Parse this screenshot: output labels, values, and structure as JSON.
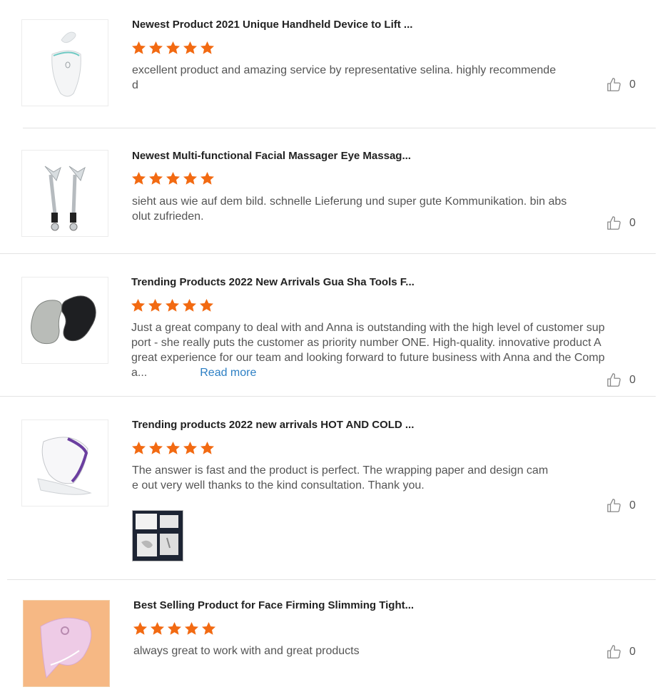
{
  "colors": {
    "star": "#f26a12",
    "link": "#2c7fc4",
    "divider": "#e3e3e3"
  },
  "reviews": [
    {
      "title": "Newest Product 2021 Unique Handheld Device to Lift ...",
      "rating": 5,
      "text": "excellent product and amazing service by representative selina. highly recommended",
      "likes": "0",
      "thumbnail_icon": "facial-lift-device-icon"
    },
    {
      "title": "Newest Multi-functional Facial Massager Eye Massag...",
      "rating": 5,
      "text": "sieht aus wie auf dem bild. schnelle Lieferung und super gute Kommunikation. bin absolut zufrieden.",
      "likes": "0",
      "thumbnail_icon": "eye-massager-icon"
    },
    {
      "title": "Trending Products 2022 New Arrivals Gua Sha Tools F...",
      "rating": 5,
      "text": "Just a great company to deal with and Anna is outstanding with the high level of customer support - she really puts the customer as priority number ONE. High-quality. innovative product A great experience for our team and looking forward to future business with Anna and the Compa...",
      "read_more": "Read more",
      "likes": "0",
      "thumbnail_icon": "gua-sha-stones-icon"
    },
    {
      "title": "Trending products 2022 new arrivals HOT AND COLD ...",
      "rating": 5,
      "text": "The answer is fast and the product is perfect. The wrapping paper and design came out very well thanks to the kind consultation. Thank you.",
      "likes": "0",
      "thumbnail_icon": "hot-cold-gua-sha-icon",
      "photo_icon": "packaging-photo-icon"
    },
    {
      "title": "Best Selling Product for Face Firming Slimming Tight...",
      "rating": 5,
      "text": "always great to work with and great products",
      "likes": "0",
      "thumbnail_icon": "pink-massager-icon"
    }
  ]
}
